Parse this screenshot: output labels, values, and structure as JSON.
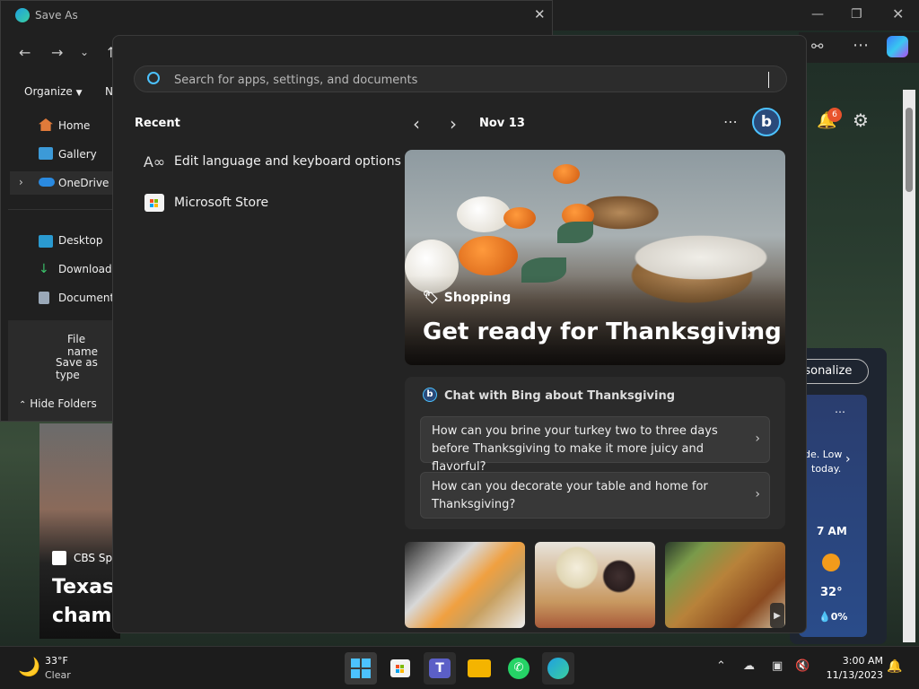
{
  "saveas": {
    "title": "Save As",
    "organize_label": "Organize",
    "new_folder_partial": "N",
    "sidebar": [
      {
        "label": "Home"
      },
      {
        "label": "Gallery"
      },
      {
        "label": "OneDrive"
      },
      {
        "label": "Desktop"
      },
      {
        "label": "Downloads"
      },
      {
        "label": "Documents"
      }
    ],
    "file_name_label": "File name",
    "save_type_label": "Save as type",
    "hide_folders_label": "Hide Folders"
  },
  "search": {
    "placeholder": "Search for apps, settings, and documents"
  },
  "recent": {
    "heading": "Recent",
    "items": [
      {
        "label": "Edit language and keyboard options"
      },
      {
        "label": "Microsoft Store"
      }
    ]
  },
  "widgets": {
    "date": "Nov 13",
    "hero": {
      "tag": "Shopping",
      "title": "Get ready for Thanksgiving"
    },
    "chat": {
      "title": "Chat with Bing about Thanksgiving",
      "questions": [
        {
          "text": "How can you brine your turkey two to three days before Thanksgiving to make it more juicy and flavorful?"
        },
        {
          "text": "How can you decorate your table and home for Thanksgiving?"
        }
      ]
    }
  },
  "browser_bg": {
    "notification_count": "6",
    "personalize_partial": "ersonalize",
    "weather_card_text_1": "de. Low",
    "weather_card_text_2": "today.",
    "hour": "7 AM",
    "temp": "32°",
    "precip": "0%",
    "news_source": "CBS Spo",
    "news_title_1": "Texas",
    "news_title_2": "champ"
  },
  "taskbar": {
    "weather_temp": "33°F",
    "weather_desc": "Clear",
    "time": "3:00 AM",
    "date": "11/13/2023"
  },
  "colors": {
    "accent": "#4cc2ff",
    "orange": "#e87a24"
  }
}
